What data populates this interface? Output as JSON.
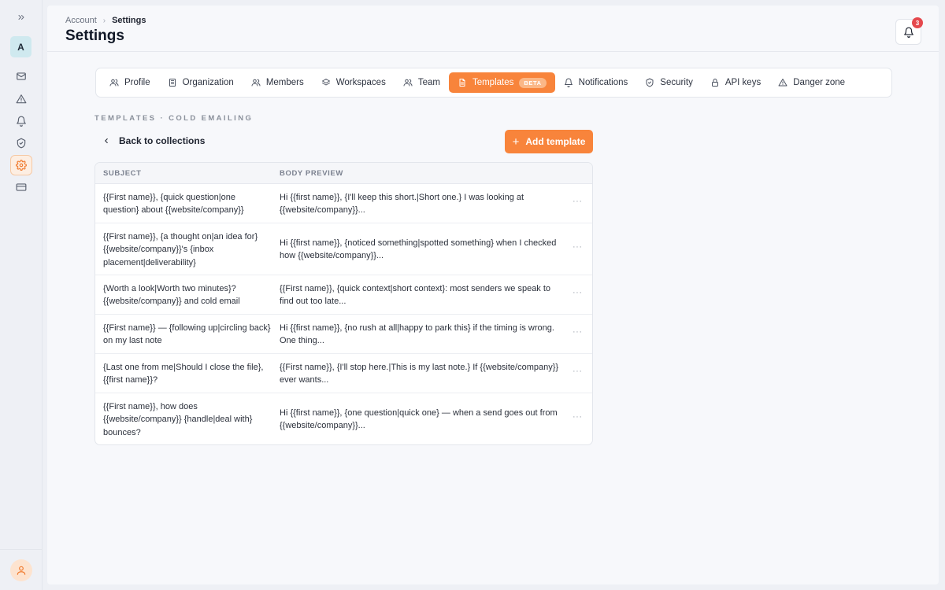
{
  "sidebar": {
    "expand_icon": "chevrons-right-icon",
    "workspace_initial": "A",
    "nav_icons": [
      "mail-icon",
      "alert-triangle-icon",
      "bell-icon",
      "shield-icon",
      "gear-icon",
      "credit-card-icon"
    ],
    "active_index": 4,
    "user_icon": "user-icon"
  },
  "header": {
    "breadcrumb": {
      "parent": "Account",
      "current": "Settings"
    },
    "title": "Settings",
    "notifications_count": "3"
  },
  "tabs": [
    {
      "label": "Profile",
      "icon": "users-icon"
    },
    {
      "label": "Organization",
      "icon": "building-icon"
    },
    {
      "label": "Members",
      "icon": "users-icon"
    },
    {
      "label": "Workspaces",
      "icon": "layers-icon"
    },
    {
      "label": "Team",
      "icon": "users-icon"
    },
    {
      "label": "Templates",
      "icon": "file-text-icon",
      "badge": "BETA",
      "active": true
    },
    {
      "label": "Notifications",
      "icon": "bell-icon"
    },
    {
      "label": "Security",
      "icon": "shield-icon"
    },
    {
      "label": "API keys",
      "icon": "lock-icon"
    },
    {
      "label": "Danger zone",
      "icon": "alert-triangle-icon"
    }
  ],
  "content": {
    "section_label": "TEMPLATES · COLD EMAILING",
    "back_label": "Back to collections",
    "add_label": "Add template"
  },
  "table": {
    "headers": {
      "subject": "SUBJECT",
      "body": "BODY PREVIEW"
    },
    "more_label": "···",
    "rows": [
      {
        "subject": "{{First name}}, {quick question|one question} about {{website/company}}",
        "body": "Hi {{first name}}, {I'll keep this short.|Short one.} I was looking at {{website/company}}..."
      },
      {
        "subject": "{{First name}}, {a thought on|an idea for} {{website/company}}'s {inbox placement|deliverability}",
        "body": "Hi {{first name}}, {noticed something|spotted something} when I checked how {{website/company}}..."
      },
      {
        "subject": "{Worth a look|Worth two minutes}? {{website/company}} and cold email",
        "body": "{{First name}}, {quick context|short context}: most senders we speak to find out too late..."
      },
      {
        "subject": "{{First name}} — {following up|circling back} on my last note",
        "body": "Hi {{first name}}, {no rush at all|happy to park this} if the timing is wrong. One thing..."
      },
      {
        "subject": "{Last one from me|Should I close the file}, {{first name}}?",
        "body": "{{First name}}, {I'll stop here.|This is my last note.} If {{website/company}} ever wants..."
      },
      {
        "subject": "{{First name}}, how does {{website/company}} {handle|deal with} bounces?",
        "body": "Hi {{first name}}, {one question|quick one} — when a send goes out from {{website/company}}..."
      }
    ]
  },
  "colors": {
    "accent": "#f8843b",
    "badge_red": "#e5484d"
  }
}
